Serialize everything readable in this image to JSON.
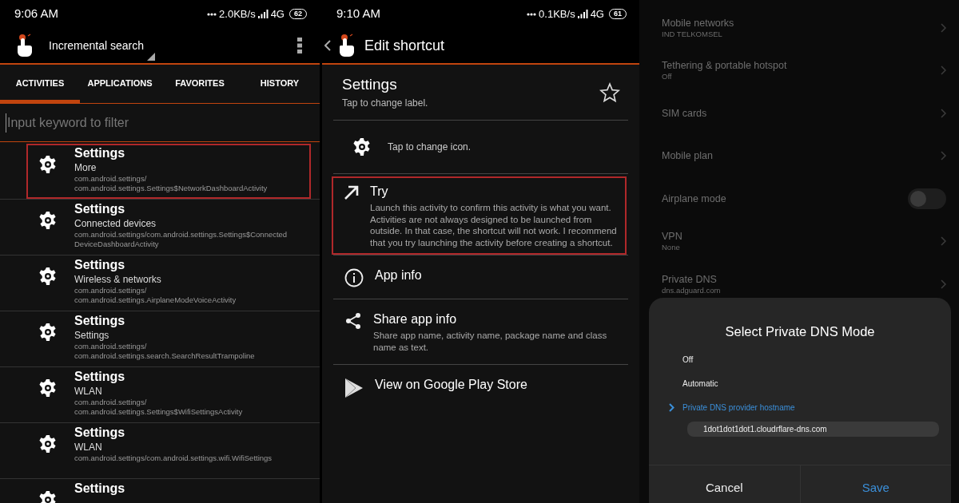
{
  "search_screen": {
    "status_bar": {
      "time": "9:06 AM",
      "speed": "2.0KB/s",
      "network": "4G",
      "battery": "62"
    },
    "toolbar": {
      "title": "Incremental search"
    },
    "tabs": [
      {
        "label": "ACTIVITIES",
        "selected": true
      },
      {
        "label": "APPLICATIONS",
        "selected": false
      },
      {
        "label": "FAVORITES",
        "selected": false
      },
      {
        "label": "HISTORY",
        "selected": false
      }
    ],
    "filter": {
      "placeholder": "Input keyword to filter"
    },
    "activities": [
      {
        "title": "Settings",
        "subtitle": "More",
        "package_lines": [
          "com.android.settings/",
          "com.android.settings.Settings$NetworkDashboardActivity"
        ],
        "highlighted": true
      },
      {
        "title": "Settings",
        "subtitle": "Connected devices",
        "package_lines": [
          "com.android.settings/com.android.settings.Settings$Connected",
          "DeviceDashboardActivity"
        ],
        "highlighted": false
      },
      {
        "title": "Settings",
        "subtitle": "Wireless & networks",
        "package_lines": [
          "com.android.settings/",
          "com.android.settings.AirplaneModeVoiceActivity"
        ],
        "highlighted": false
      },
      {
        "title": "Settings",
        "subtitle": "Settings",
        "package_lines": [
          "com.android.settings/",
          "com.android.settings.search.SearchResultTrampoline"
        ],
        "highlighted": false
      },
      {
        "title": "Settings",
        "subtitle": "WLAN",
        "package_lines": [
          "com.android.settings/",
          "com.android.settings.Settings$WifiSettingsActivity"
        ],
        "highlighted": false
      },
      {
        "title": "Settings",
        "subtitle": "WLAN",
        "package_lines": [
          "com.android.settings/com.android.settings.wifi.WifiSettings"
        ],
        "highlighted": false
      },
      {
        "title": "Settings",
        "highlighted": false
      }
    ]
  },
  "edit_shortcut_screen": {
    "status_bar": {
      "time": "9:10 AM",
      "speed": "0.1KB/s",
      "network": "4G",
      "battery": "61"
    },
    "toolbar": {
      "title": "Edit shortcut"
    },
    "label": {
      "title": "Settings",
      "hint": "Tap to change label.",
      "favorite": false
    },
    "icon_row": {
      "hint": "Tap to change icon."
    },
    "actions": [
      {
        "kind": "try",
        "title": "Try",
        "description": "Launch this activity to confirm this activity is what you want. Activities are not always designed to be launched from outside. In that case, the shortcut will not work. I recommend that you try launching the activity before creating a shortcut.",
        "highlighted": true
      },
      {
        "kind": "info",
        "title": "App info",
        "highlighted": false
      },
      {
        "kind": "share",
        "title": "Share app info",
        "description": "Share app name, activity name, package name and class name as text.",
        "highlighted": false
      },
      {
        "kind": "store",
        "title": "View on Google Play Store",
        "highlighted": false
      }
    ]
  },
  "network_settings_screen": {
    "items": [
      {
        "kind": "link",
        "title": "Mobile networks",
        "summary": "IND TELKOMSEL"
      },
      {
        "kind": "link",
        "title": "Tethering & portable hotspot",
        "summary": "Off"
      },
      {
        "kind": "link",
        "title": "SIM cards"
      },
      {
        "kind": "link",
        "title": "Mobile plan"
      },
      {
        "kind": "toggle",
        "title": "Airplane mode",
        "on": false
      },
      {
        "kind": "link",
        "title": "VPN",
        "summary": "None"
      },
      {
        "kind": "link",
        "title": "Private DNS",
        "summary": "dns.adguard.com"
      }
    ],
    "dialog": {
      "title": "Select Private DNS Mode",
      "options": [
        {
          "label": "Off",
          "selected": false
        },
        {
          "label": "Automatic",
          "selected": false
        },
        {
          "label": "Private DNS provider hostname",
          "selected": true
        }
      ],
      "hostname": "1dot1dot1dot1.cloudrflare-dns.com",
      "buttons": [
        {
          "kind": "cancel",
          "label": "Cancel"
        },
        {
          "kind": "confirm",
          "label": "Save"
        }
      ]
    }
  }
}
